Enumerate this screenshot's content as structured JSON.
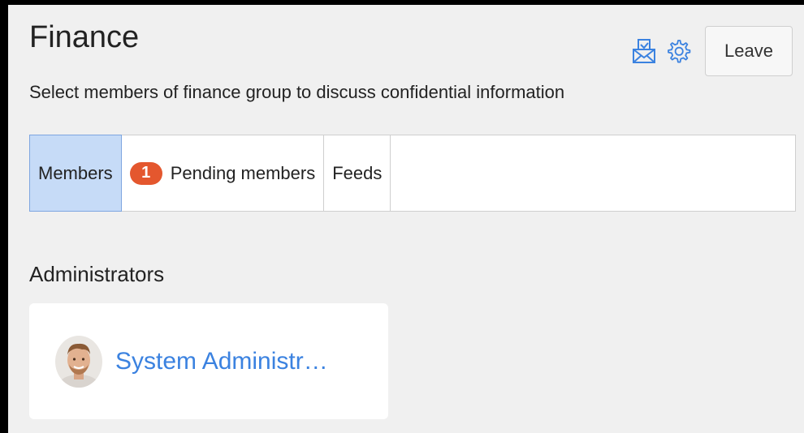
{
  "header": {
    "title": "Finance",
    "subtitle": "Select members of finance group to discuss confidential information",
    "actions": {
      "mail_icon": "envelope-icon",
      "settings_icon": "gear-icon",
      "leave_label": "Leave"
    }
  },
  "tabs": [
    {
      "label": "Members",
      "active": true
    },
    {
      "label": "Pending members",
      "badge": "1"
    },
    {
      "label": "Feeds"
    }
  ],
  "administrators": {
    "section_title": "Administrators",
    "members": [
      {
        "name": "System Administr…",
        "avatar_icon": "user-avatar"
      }
    ]
  },
  "colors": {
    "accent": "#3b82e0",
    "badge": "#e4572e",
    "active_tab": "#c6dbf7"
  }
}
